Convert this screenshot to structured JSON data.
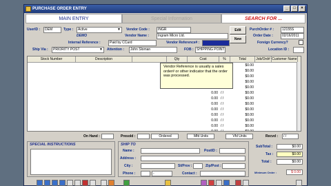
{
  "window": {
    "title": "PURCHASE ORDER ENTRY",
    "min": "_",
    "max": "□",
    "close": "×"
  },
  "tabs": {
    "main_entry": "MAIN ENTRY",
    "special_information": "Special Information",
    "search": "SEARCH FOR ..."
  },
  "header": {
    "userid_label": "UserID :",
    "userid_value": "DEM",
    "type_label": "Type :",
    "type_value": "Active",
    "vendor_code_label": "Vendor Code :",
    "vendor_code_value": "INGR",
    "edit_button": "Edit",
    "purchorder_label": "PurchOrder # :",
    "purchorder_value": "12155S",
    "demo_label": "DEMO",
    "vendor_name_label": "Vendor Name :",
    "vendor_name_value": "Ingram Micro Ltd.",
    "new_button": "New",
    "order_date_label": "Order Date :",
    "order_date_value": "02/16/2011",
    "internal_ref_label": "Internal Reference :",
    "internal_ref_value": "Paid by CCard",
    "vendor_ref_label": "Vendor Reference# :",
    "vendor_ref_value": "",
    "foreign_currency_label": "Foreign Currency?",
    "ship_via_label": "Ship Via :",
    "ship_via_value": "PRIORITY POST",
    "attention_label": "Attention :",
    "attention_value": "John Sloman",
    "fob_label": "FOB :",
    "fob_value": "SHIPPING POINT",
    "location_label": "Location ID :",
    "location_value": ""
  },
  "grid": {
    "columns": [
      "Stock Number",
      "Description",
      "",
      "Qty",
      "Cost",
      "%",
      "Total",
      "Job/Ord#",
      "Customer Name"
    ],
    "rows": [
      {
        "cost": "0.00",
        "pct": "/  /",
        "total": "$0.00"
      },
      {
        "cost": "0.00",
        "pct": "/  /",
        "total": "$0.00"
      },
      {
        "cost": "0.00",
        "pct": "/  /",
        "total": "$0.00"
      },
      {
        "cost": "0.00",
        "pct": "/  /",
        "total": "$0.00"
      },
      {
        "cost": "0.00",
        "pct": "/  /",
        "total": "$0.00"
      },
      {
        "cost": "0.00",
        "pct": "/  /",
        "total": "$0.00"
      },
      {
        "cost": "0.00",
        "pct": "/  /",
        "total": "$0.00"
      },
      {
        "cost": "0.00",
        "pct": "/  /",
        "total": "$0.00"
      },
      {
        "cost": "0.00",
        "pct": "/  /",
        "total": "$0.00"
      },
      {
        "cost": "0.00",
        "pct": "/  /",
        "total": "$0.00"
      },
      {
        "cost": "0.00",
        "pct": "/  /",
        "total": "$0.00"
      },
      {
        "cost": "0.00",
        "pct": "/  /",
        "total": "$0.00"
      },
      {
        "cost": "0.00",
        "pct": "/  /",
        "total": "$0.00"
      }
    ]
  },
  "tooltip": {
    "text": "Vendor Reference is usually a sales order# or other indicator that the order was processed."
  },
  "summary": {
    "on_hand": "On Hand :",
    "presold": "Presold :",
    "ordered": "Ordered",
    "mfd_units": "Mfd Units",
    "vfd_units": "Vfd Units",
    "recvd": "Recvd :",
    "recvd_value": "/ /"
  },
  "special_instructions": {
    "title": "SPECIAL INSTRUCTIONS",
    "value": ""
  },
  "ship_to": {
    "title": "SHIP TO",
    "name_label": "Name :",
    "postid_label": "PostID :",
    "address_label": "Address :",
    "city_label": "City :",
    "st_prov_label": "St/Prov :",
    "zip_label": "Zip/Post :",
    "phone_label": "Phone :",
    "phone_sep": "-",
    "contact_label": "Contact :"
  },
  "totals": {
    "subtotal_label": "SubTotal :",
    "subtotal_value": "$0.00",
    "tax_label": "Tax :",
    "tax_value": "$0.00",
    "total_label": "Total :",
    "total_value": "$0.00",
    "min_order_label": "Minimum Order :",
    "min_order_value": "$ 0.00"
  }
}
